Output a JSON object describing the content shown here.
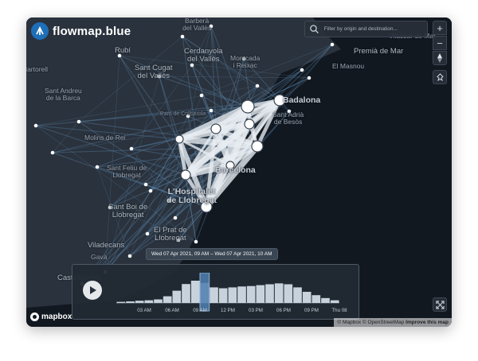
{
  "app": {
    "name": "flowmap.blue"
  },
  "search": {
    "placeholder": "Filter by origin and destination..."
  },
  "controls": {
    "zoom_in": "+",
    "zoom_out": "−"
  },
  "places": [
    {
      "name": "Barberà\ndel Vallès",
      "class": "place"
    },
    {
      "name": "Vilassar de Mar",
      "class": "place"
    },
    {
      "name": "Premià de Mar",
      "class": "place mid"
    },
    {
      "name": "Rubí",
      "class": "place mid"
    },
    {
      "name": "Cerdanyola\ndel Vallès",
      "class": "place mid"
    },
    {
      "name": "Montcada\ni Reixac",
      "class": "place"
    },
    {
      "name": "El Masnou",
      "class": "place"
    },
    {
      "name": "Martorell",
      "class": "place"
    },
    {
      "name": "Sant Cugat\ndel Vallès",
      "class": "place mid"
    },
    {
      "name": "Sant Andreu\nde la Barca",
      "class": "place"
    },
    {
      "name": "Parc de Collserola",
      "class": "place small"
    },
    {
      "name": "Badalona",
      "class": "place big"
    },
    {
      "name": "Sant Adrià\nde Besòs",
      "class": "place"
    },
    {
      "name": "Molins de Rei",
      "class": "place"
    },
    {
      "name": "Sant Feliu de\nLlobregat",
      "class": "place"
    },
    {
      "name": "Barcelona",
      "class": "place big"
    },
    {
      "name": "L'Hospitalet\nde Llobregat",
      "class": "place big"
    },
    {
      "name": "Sant Boi de\nLlobregat",
      "class": "place mid"
    },
    {
      "name": "El Prat de\nLlobregat",
      "class": "place mid"
    },
    {
      "name": "Viladecans",
      "class": "place mid"
    },
    {
      "name": "Gavà",
      "class": "place"
    },
    {
      "name": "Castelldefels",
      "class": "place mid"
    }
  ],
  "timeline": {
    "selection_label": "Wed 07 Apr 2021, 09 AM – Wed 07 Apr 2021, 10 AM",
    "hourly_counts": [
      0.05,
      0.07,
      0.1,
      0.12,
      0.16,
      0.3,
      0.55,
      0.85,
      1.0,
      0.9,
      0.7,
      0.66,
      0.7,
      0.74,
      0.76,
      0.8,
      0.84,
      0.88,
      0.84,
      0.7,
      0.5,
      0.35,
      0.22,
      0.12
    ],
    "selected_hour": 9,
    "tick_labels": [
      "03 AM",
      "06 AM",
      "09 AM",
      "12 PM",
      "03 PM",
      "06 PM",
      "09 PM",
      "Thu 08"
    ],
    "bar_color": "#c8d2dc",
    "selection_color": "#4f7fb0"
  },
  "attribution": {
    "mapbox": "mapbox",
    "copyright": "© Mapbox © OpenStreetMap",
    "improve": "Improve this map"
  },
  "colors": {
    "water": "#121820",
    "land": "#2a323d",
    "flow": "#5d88ad",
    "node": "#ffffff"
  }
}
